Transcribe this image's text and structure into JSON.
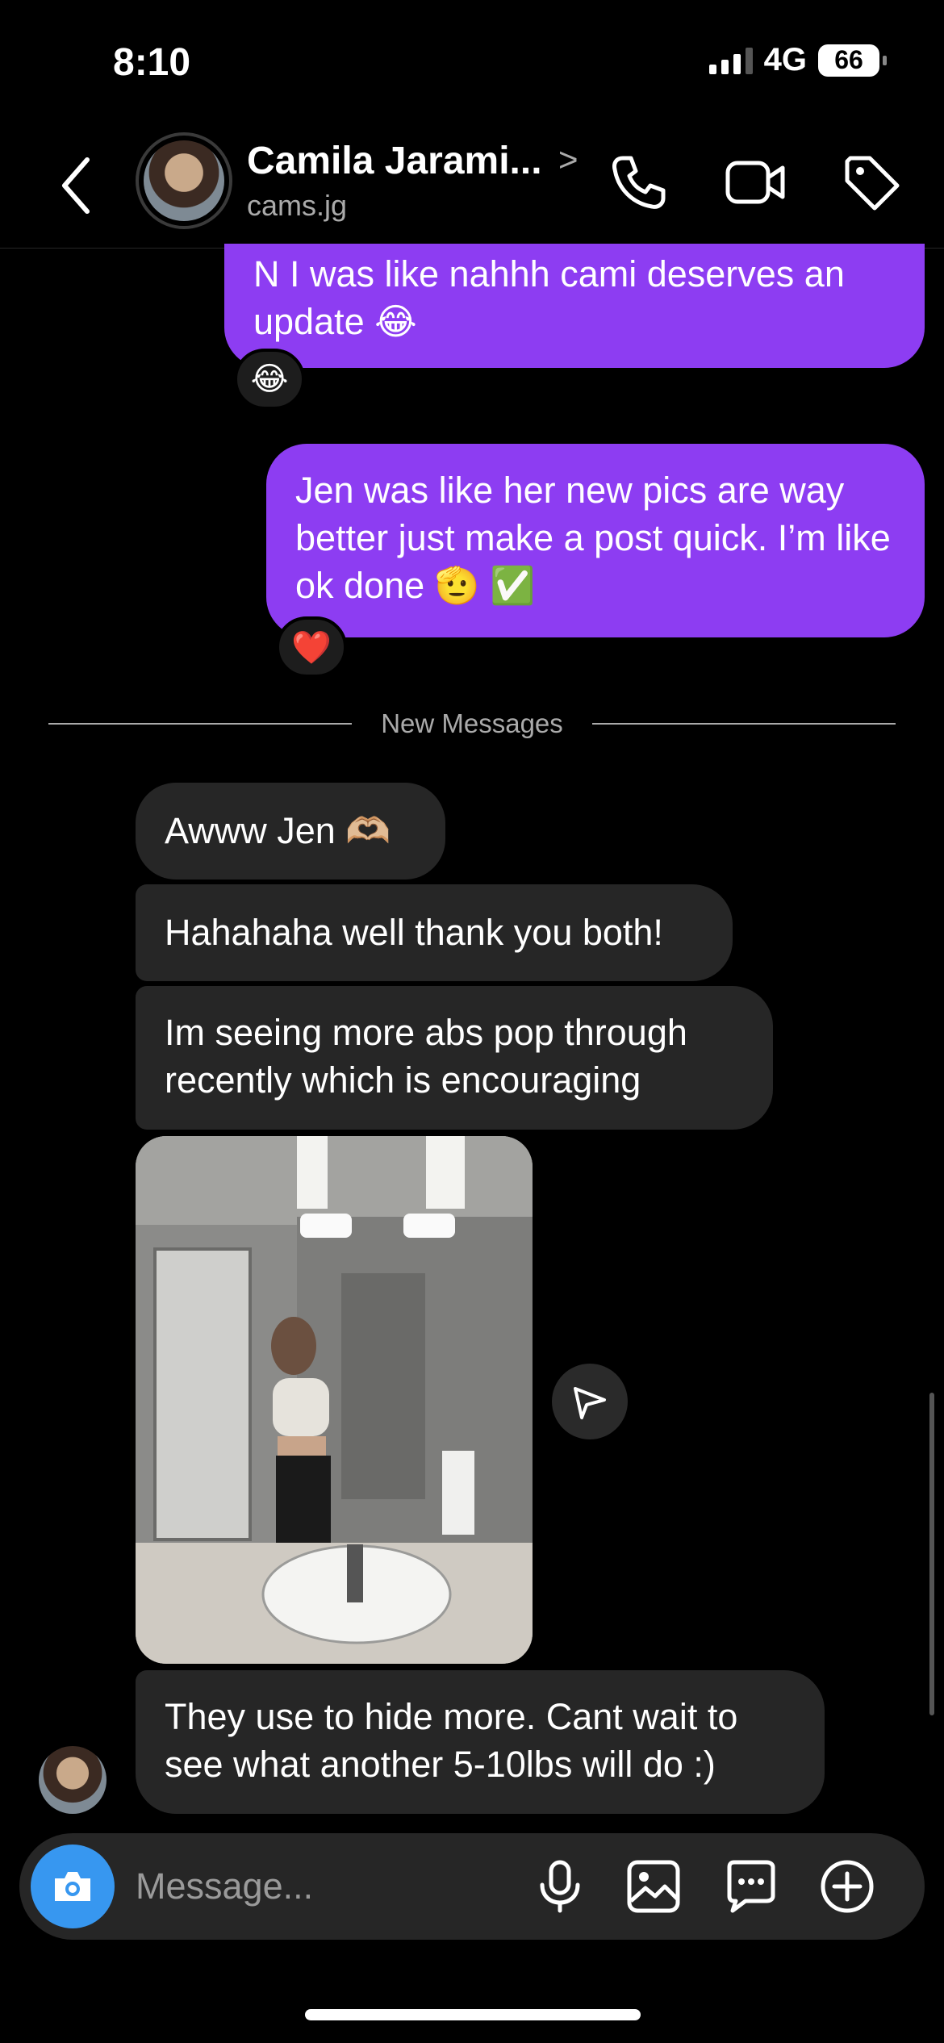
{
  "status": {
    "time": "8:10",
    "network": "4G",
    "battery": "66"
  },
  "header": {
    "contact_name": "Camila Jarami...",
    "handle": "cams.jg",
    "chevron": ">",
    "icons": [
      "back-icon",
      "phone-icon",
      "video-camera-icon",
      "tag-icon"
    ]
  },
  "messages": {
    "sent": [
      {
        "text": "N I was like nahhh cami deserves an update 😂",
        "reaction": "😂"
      },
      {
        "text": "Jen was like her new pics are way better just make a post quick. I’m like ok done 🫡 ✅",
        "reaction": "❤️"
      }
    ],
    "divider": "New Messages",
    "received": [
      {
        "text": "Awww Jen 🫶🏼"
      },
      {
        "text": "Hahahaha well thank you both!"
      },
      {
        "text": "Im seeing more abs pop through recently which is encouraging"
      },
      {
        "type": "photo",
        "description_icon": "photo-icon"
      },
      {
        "text": "They use to hide more. Cant wait to see what another 5-10lbs will do :)"
      }
    ]
  },
  "composer": {
    "placeholder": "Message...",
    "icons": [
      "camera-icon",
      "microphone-icon",
      "gallery-icon",
      "sticker-icon",
      "plus-icon"
    ]
  },
  "colors": {
    "sent_bubble": "#8d3df2",
    "received_bubble": "#262626",
    "camera_button": "#3797f0",
    "background": "#000000"
  }
}
